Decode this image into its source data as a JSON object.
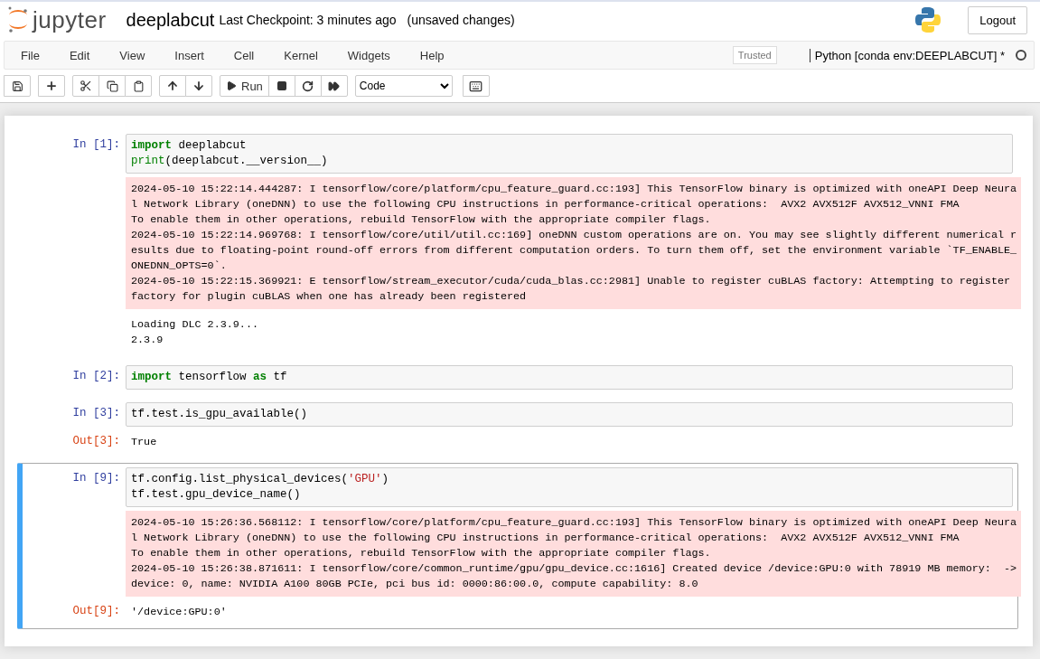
{
  "header": {
    "logo_text": "jupyter",
    "notebook_name": "deeplabcut",
    "checkpoint": "Last Checkpoint: 3 minutes ago",
    "autosave_status": "(unsaved changes)",
    "logout": "Logout"
  },
  "menubar": {
    "items": [
      "File",
      "Edit",
      "View",
      "Insert",
      "Cell",
      "Kernel",
      "Widgets",
      "Help"
    ],
    "trusted": "Trusted",
    "kernel_name": "Python [conda env:DEEPLABCUT] *",
    "kernel_busy": false
  },
  "toolbar": {
    "run_label": "Run",
    "cell_type": "Code"
  },
  "cells": [
    {
      "selected": false,
      "prompt": "In [1]:",
      "code": [
        [
          {
            "text": "import",
            "kind": "keyword"
          },
          {
            "text": " deeplabcut",
            "kind": "plain"
          }
        ],
        [
          {
            "text": "print",
            "kind": "builtin"
          },
          {
            "text": "(deeplabcut.__version__)",
            "kind": "plain"
          }
        ]
      ],
      "outputs": [
        {
          "kind": "stderr",
          "lines": [
            "2024-05-10 15:22:14.444287: I tensorflow/core/platform/cpu_feature_guard.cc:193] This TensorFlow binary is optimized with oneAPI Deep Neura",
            "l Network Library (oneDNN) to use the following CPU instructions in performance-critical operations:  AVX2 AVX512F AVX512_VNNI FMA",
            "To enable them in other operations, rebuild TensorFlow with the appropriate compiler flags.",
            "2024-05-10 15:22:14.969768: I tensorflow/core/util/util.cc:169] oneDNN custom operations are on. You may see slightly different numerical r",
            "esults due to floating-point round-off errors from different computation orders. To turn them off, set the environment variable `TF_ENABLE_",
            "ONEDNN_OPTS=0`.",
            "2024-05-10 15:22:15.369921: E tensorflow/stream_executor/cuda/cuda_blas.cc:2981] Unable to register cuBLAS factory: Attempting to register",
            "factory for plugin cuBLAS when one has already been registered"
          ]
        },
        {
          "kind": "stream",
          "lines": [
            "Loading DLC 2.3.9...",
            "2.3.9"
          ]
        }
      ]
    },
    {
      "selected": false,
      "prompt": "In [2]:",
      "code": [
        [
          {
            "text": "import",
            "kind": "keyword"
          },
          {
            "text": " tensorflow ",
            "kind": "plain"
          },
          {
            "text": "as",
            "kind": "keyword"
          },
          {
            "text": " tf",
            "kind": "plain"
          }
        ]
      ]
    },
    {
      "selected": false,
      "prompt": "In [3]:",
      "code": [
        [
          {
            "text": "tf.test.is_gpu_available()",
            "kind": "plain"
          }
        ]
      ],
      "outputs": [
        {
          "kind": "result",
          "prompt": "Out[3]:",
          "lines": [
            "True"
          ]
        }
      ]
    },
    {
      "selected": true,
      "prompt": "In [9]:",
      "code": [
        [
          {
            "text": "tf.config.list_physical_devices(",
            "kind": "plain"
          },
          {
            "text": "'GPU'",
            "kind": "string"
          },
          {
            "text": ")",
            "kind": "plain"
          }
        ],
        [
          {
            "text": "tf.test.gpu_device_name()",
            "kind": "plain"
          }
        ]
      ],
      "outputs": [
        {
          "kind": "stderr",
          "lines": [
            "2024-05-10 15:26:36.568112: I tensorflow/core/platform/cpu_feature_guard.cc:193] This TensorFlow binary is optimized with oneAPI Deep Neura",
            "l Network Library (oneDNN) to use the following CPU instructions in performance-critical operations:  AVX2 AVX512F AVX512_VNNI FMA",
            "To enable them in other operations, rebuild TensorFlow with the appropriate compiler flags.",
            "2024-05-10 15:26:38.871611: I tensorflow/core/common_runtime/gpu/gpu_device.cc:1616] Created device /device:GPU:0 with 78919 MB memory:  ->",
            "device: 0, name: NVIDIA A100 80GB PCIe, pci bus id: 0000:86:00.0, compute capability: 8.0"
          ]
        },
        {
          "kind": "result",
          "prompt": "Out[9]:",
          "lines": [
            "'/device:GPU:0'"
          ]
        }
      ]
    }
  ]
}
